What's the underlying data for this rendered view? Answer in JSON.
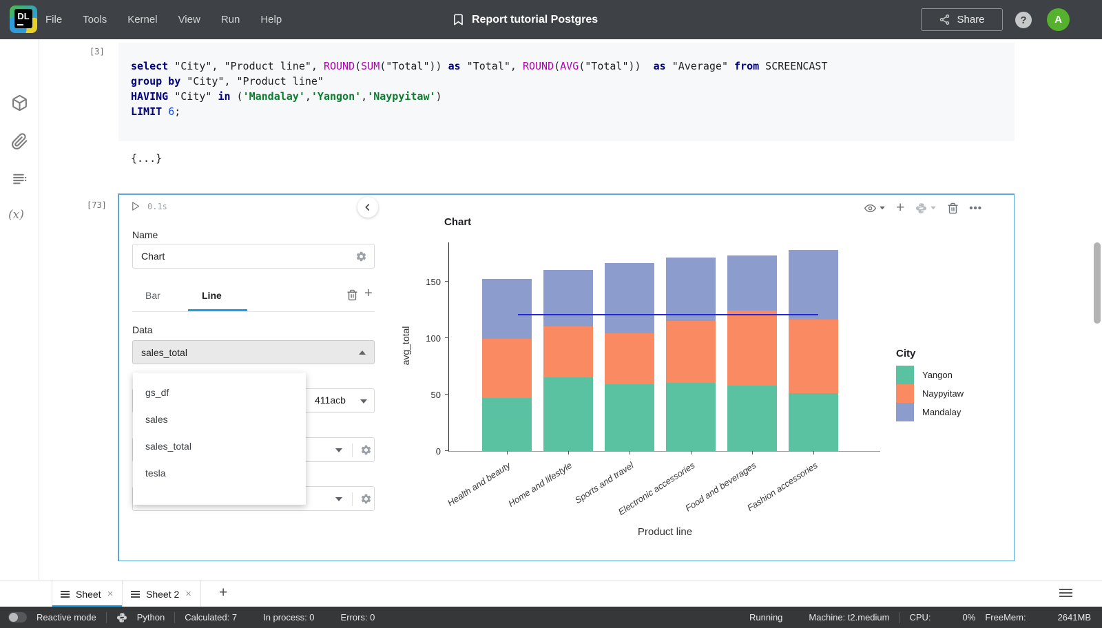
{
  "topbar": {
    "logo_text": "DL",
    "menus": [
      "File",
      "Tools",
      "Kernel",
      "View",
      "Run",
      "Help"
    ],
    "title": "Report tutorial Postgres",
    "share_label": "Share",
    "help_label": "?",
    "avatar_label": "A"
  },
  "sidebar": {
    "variables_label": "(x)"
  },
  "code_cell": {
    "exec_label": "[3]",
    "lines": [
      [
        {
          "t": "select",
          "c": "kw"
        },
        {
          "t": " \"City\", \"Product line\", ",
          "c": "pl"
        },
        {
          "t": "ROUND",
          "c": "fn"
        },
        {
          "t": "(",
          "c": "pl"
        },
        {
          "t": "SUM",
          "c": "fn"
        },
        {
          "t": "(\"Total\")) ",
          "c": "pl"
        },
        {
          "t": "as",
          "c": "kw"
        },
        {
          "t": " \"Total\", ",
          "c": "pl"
        },
        {
          "t": "ROUND",
          "c": "fn"
        },
        {
          "t": "(",
          "c": "pl"
        },
        {
          "t": "AVG",
          "c": "fn"
        },
        {
          "t": "(\"Total\"))  ",
          "c": "pl"
        },
        {
          "t": "as",
          "c": "kw"
        },
        {
          "t": " \"Average\" ",
          "c": "pl"
        },
        {
          "t": "from",
          "c": "kw"
        },
        {
          "t": " SCREENCAST",
          "c": "pl"
        }
      ],
      [
        {
          "t": "group by",
          "c": "kw"
        },
        {
          "t": " \"City\", \"Product line\"",
          "c": "pl"
        }
      ],
      [
        {
          "t": "HAVING",
          "c": "kw"
        },
        {
          "t": " \"City\" ",
          "c": "pl"
        },
        {
          "t": "in",
          "c": "kw"
        },
        {
          "t": " (",
          "c": "pl"
        },
        {
          "t": "'Mandalay'",
          "c": "str"
        },
        {
          "t": ",",
          "c": "pl"
        },
        {
          "t": "'Yangon'",
          "c": "str"
        },
        {
          "t": ",",
          "c": "pl"
        },
        {
          "t": "'Naypyitaw'",
          "c": "str"
        },
        {
          "t": ")",
          "c": "pl"
        }
      ],
      [
        {
          "t": "LIMIT",
          "c": "kw"
        },
        {
          "t": " ",
          "c": "pl"
        },
        {
          "t": "6",
          "c": "num"
        },
        {
          "t": ";",
          "c": "pl"
        }
      ]
    ],
    "output_label": "{...}"
  },
  "chart_cell": {
    "exec_label": "[73]",
    "run_time": "0.1s",
    "name_label": "Name",
    "name_value": "Chart",
    "tab_bar": "Bar",
    "tab_line": "Line",
    "data_label": "Data",
    "data_value": "sales_total",
    "dropdown_items": [
      "gs_df",
      "sales",
      "sales_total",
      "tesla"
    ],
    "partial_field_value": "411acb",
    "y_field_value": "avg_total"
  },
  "chart_data": {
    "type": "bar",
    "stacked": true,
    "title": "Chart",
    "xlabel": "Product line",
    "ylabel": "avg_total",
    "legend_title": "City",
    "legend_position": "right",
    "categories": [
      "Health and beauty",
      "Home and lifestyle",
      "Sports and travel",
      "Electronic accessories",
      "Food and beverages",
      "Fashion accessories"
    ],
    "series": [
      {
        "name": "Yangon",
        "color": "#5BC2A1",
        "values": [
          47,
          65,
          59,
          60,
          58,
          51
        ]
      },
      {
        "name": "Naypyitaw",
        "color": "#FA8A61",
        "values": [
          52,
          45,
          45,
          55,
          66,
          65
        ]
      },
      {
        "name": "Mandalay",
        "color": "#8C9DCD",
        "values": [
          53,
          50,
          62,
          56,
          49,
          62
        ]
      }
    ],
    "stack_totals": [
      152,
      160,
      166,
      171,
      173,
      178
    ],
    "overlay_line": {
      "type": "line",
      "value": 120,
      "color": "#2525DD"
    },
    "yticks": [
      0,
      50,
      100,
      150
    ],
    "ylim": [
      0,
      185
    ],
    "grid": false
  },
  "sheets": {
    "tabs": [
      {
        "label": "Sheet",
        "active": true
      },
      {
        "label": "Sheet 2",
        "active": false
      }
    ],
    "add_label": "+"
  },
  "statusbar": {
    "reactive_label": "Reactive mode",
    "python_label": "Python",
    "calculated": "Calculated: 7",
    "in_process": "In process: 0",
    "errors": "Errors: 0",
    "running": "Running",
    "machine": "Machine: t2.medium",
    "cpu_label": "CPU:",
    "cpu_value": "0%",
    "freemem_label": "FreeMem:",
    "freemem_value": "2641MB"
  }
}
